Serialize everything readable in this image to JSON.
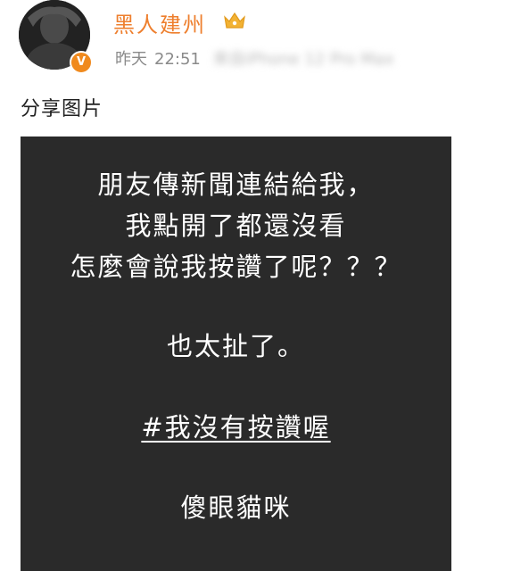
{
  "user": {
    "name": "黑人建州",
    "verified_badge": "V",
    "vip_icon": "crown-icon"
  },
  "post": {
    "date": "昨天",
    "time": "22:51",
    "source": "來自iPhone 12 Pro Max",
    "text": "分享图片"
  },
  "image": {
    "lines": [
      "朋友傳新聞連結給我，",
      "我點開了都還沒看",
      "怎麼會說我按讚了呢？？？",
      "也太扯了。",
      "#我沒有按讚喔",
      "傻眼貓咪"
    ]
  },
  "colors": {
    "username": "#ee7f2e",
    "card_background": "#2a2a2a",
    "verified_badge": "#f08a1e"
  }
}
